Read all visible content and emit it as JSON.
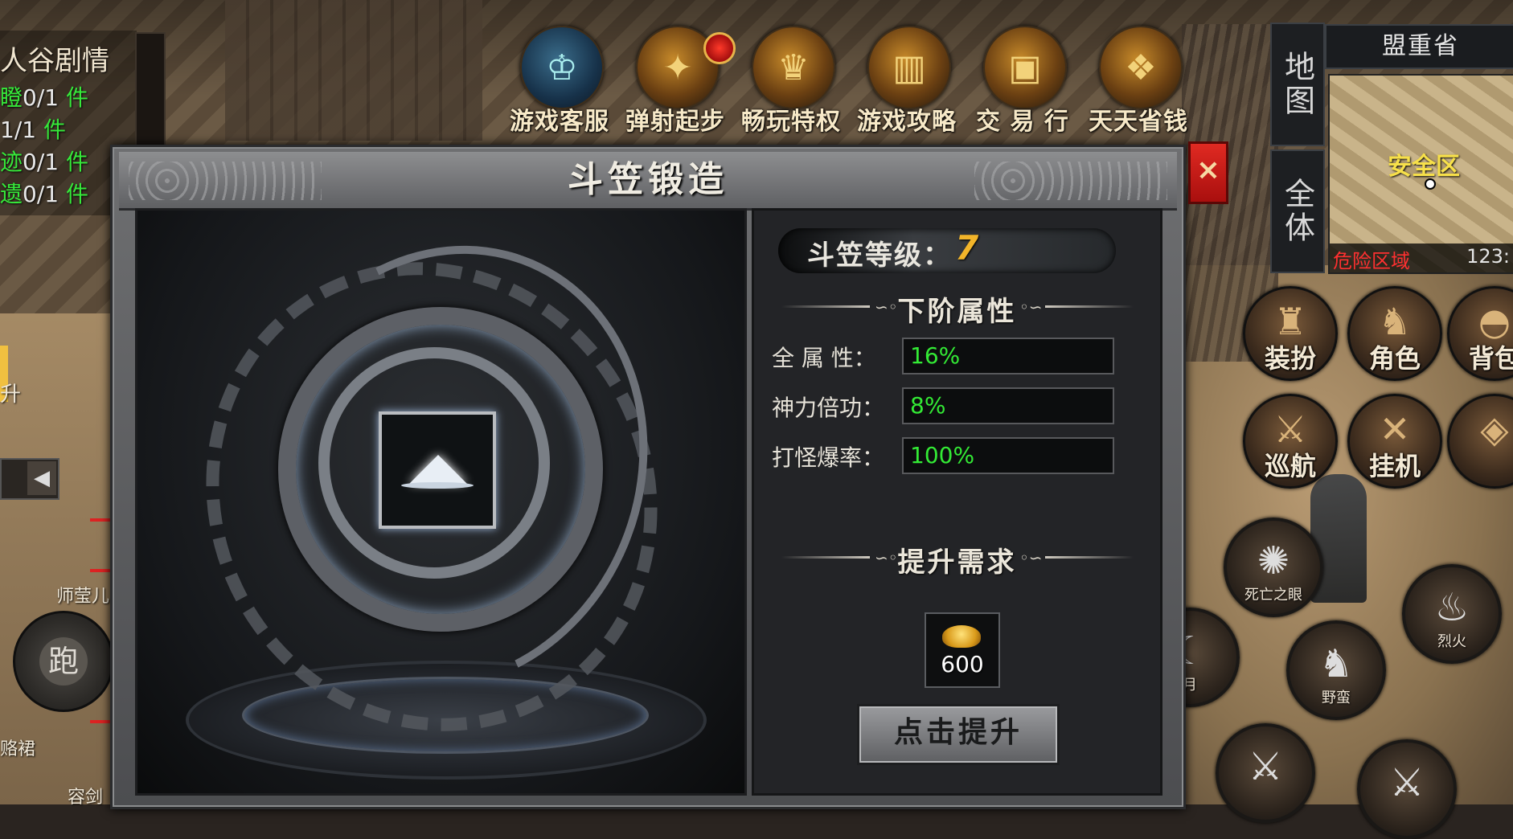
{
  "top_menu": [
    {
      "label": "游戏客服",
      "icon": "customer-service-icon"
    },
    {
      "label": "弹射起步",
      "icon": "gold-treasure-icon"
    },
    {
      "label": "畅玩特权",
      "icon": "privilege-cauldron-icon"
    },
    {
      "label": "游戏攻略",
      "icon": "guide-books-icon"
    },
    {
      "label": "交 易 行",
      "icon": "trade-chest-icon"
    },
    {
      "label": "天天省钱",
      "icon": "savings-chest-icon"
    }
  ],
  "quest": {
    "title": "人谷剧情",
    "lines": [
      {
        "name": "瞪",
        "progress": "0/1",
        "unit": "件"
      },
      {
        "name": "",
        "progress": "1/1",
        "unit": "件"
      },
      {
        "name": "迹",
        "progress": "0/1",
        "unit": "件"
      },
      {
        "name": "遗",
        "progress": "0/1",
        "unit": "件"
      }
    ]
  },
  "left_labels": {
    "npc1": "师莹儿",
    "npc2": "赂裙",
    "npc3": "容剑",
    "side": "升"
  },
  "run_button": "跑",
  "map": {
    "name": "盟重省",
    "tab_map": "地图",
    "tab_all": "全体",
    "safe_zone": "安全区",
    "danger_zone": "危险区域",
    "coords": "123:"
  },
  "right_buttons": [
    {
      "label": "装扮",
      "icon": "costume-icon"
    },
    {
      "label": "角色",
      "icon": "character-icon"
    },
    {
      "label": "背包",
      "icon": "bag-icon"
    },
    {
      "label": "巡航",
      "icon": "cruise-sword-icon"
    },
    {
      "label": "挂机",
      "icon": "crossed-swords-icon"
    },
    {
      "label": "",
      "icon": "settings-grid-icon"
    }
  ],
  "skills": [
    {
      "label": "死亡之眼",
      "icon": "death-eye-icon"
    },
    {
      "label": "烈火",
      "icon": "fire-sword-icon"
    },
    {
      "label": "野蛮",
      "icon": "barbarian-icon"
    },
    {
      "label": "月",
      "icon": "moon-sword-icon"
    }
  ],
  "dialog": {
    "title": "斗笠锻造",
    "close_label": "×",
    "level_label": "斗笠等级：",
    "level_value": "7",
    "next_attr_header": "下阶属性",
    "attributes": [
      {
        "label": "全 属 性：",
        "value": "16%"
      },
      {
        "label": "神力倍功：",
        "value": "8%"
      },
      {
        "label": "打怪爆率：",
        "value": "100%"
      }
    ],
    "requirement_header": "提升需求",
    "cost_value": "600",
    "upgrade_button": "点击提升"
  }
}
